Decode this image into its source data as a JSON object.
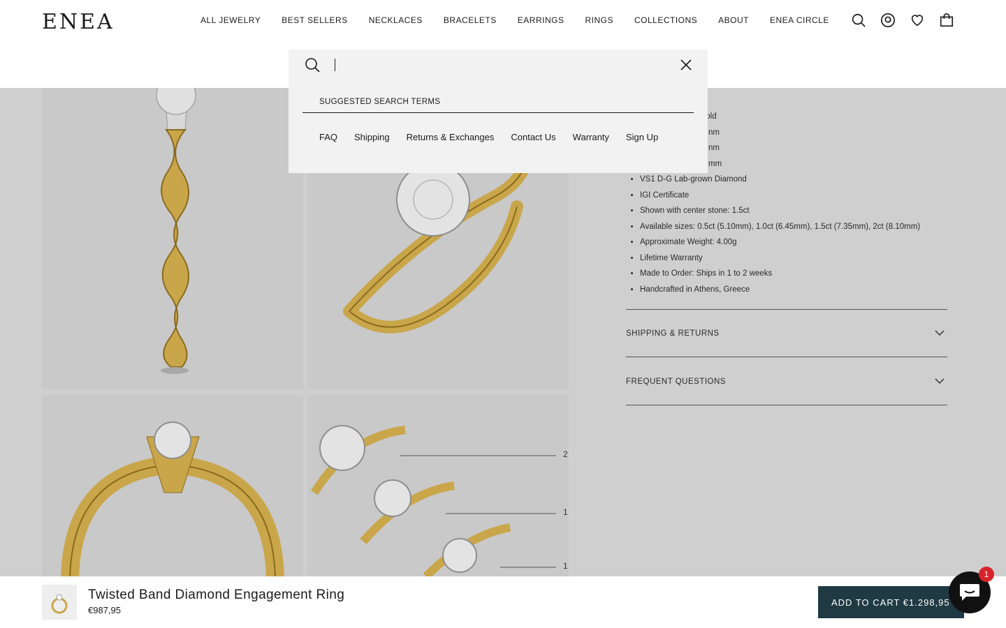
{
  "brand": {
    "logo_text": "ENEA"
  },
  "nav": {
    "items": [
      "ALL JEWELRY",
      "BEST SELLERS",
      "NECKLACES",
      "BRACELETS",
      "EARRINGS",
      "RINGS",
      "COLLECTIONS",
      "ABOUT",
      "ENEA CIRCLE"
    ]
  },
  "header_icons": [
    "search-icon",
    "account-icon",
    "wishlist-heart-icon",
    "cart-bag-icon"
  ],
  "search": {
    "value": "",
    "placeholder": "",
    "suggested_title": "SUGGESTED SEARCH TERMS",
    "suggestions": [
      "FAQ",
      "Shipping",
      "Returns & Exchanges",
      "Contact Us",
      "Warranty",
      "Sign Up"
    ]
  },
  "product": {
    "details_visible": [
      "ite Gold",
      "nm",
      "nm",
      "mm",
      "VS1 D-G Lab-grown Diamond",
      "IGI Certificate",
      "Shown with center stone: 1.5ct",
      "Available sizes: 0.5ct (5.10mm), 1.0ct (6.45mm), 1.5ct (7.35mm), 2ct (8.10mm)",
      "Approximate Weight: 4.00g",
      "Lifetime Warranty",
      "Made to Order: Ships in 1 to 2 weeks",
      "Handcrafted in Athens, Greece"
    ],
    "accordions": [
      "SHIPPING & RETURNS",
      "FREQUENT QUESTIONS"
    ],
    "size_chart_labels": [
      "2",
      "1",
      "1"
    ]
  },
  "sticky_bar": {
    "title": "Twisted Band Diamond Engagement Ring",
    "price": "€987,95",
    "add_to_cart": "ADD TO CART €1.298,95"
  },
  "chat": {
    "badge_count": "1"
  },
  "colors": {
    "accent_button": "#203a44",
    "overlay_gray": "#cfcfcf",
    "search_panel": "#f2f2f2",
    "ring_gold": "#c9a64a",
    "badge_red": "#d8232a"
  }
}
